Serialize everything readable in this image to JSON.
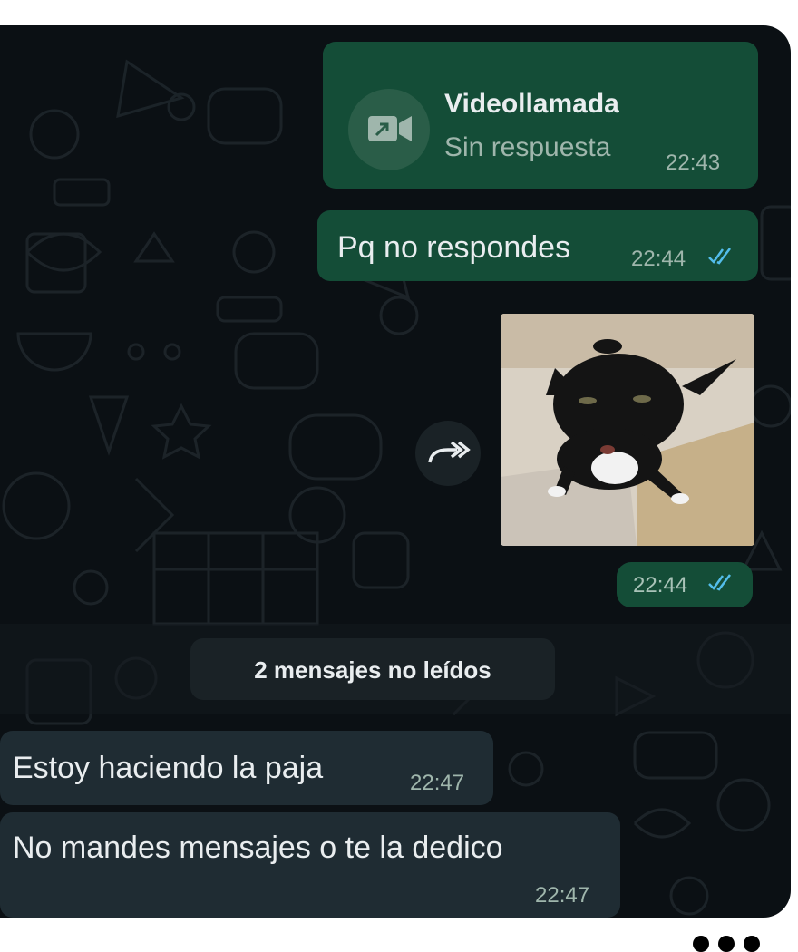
{
  "call_bubble": {
    "title": "Videollamada",
    "subtitle": "Sin respuesta",
    "time": "22:43",
    "icon": "video-call-missed-icon"
  },
  "messages_out": [
    {
      "text": "Pq no responde s",
      "time": "22:44",
      "status": "read"
    }
  ],
  "image_message": {
    "time": "22:44",
    "status": "read",
    "forward_icon": "forward-icon",
    "image_subject": "cat-photo"
  },
  "unread_divider": {
    "label": "2 mensajes no leídos"
  },
  "messages_in": [
    {
      "text": "Estoy haciendo la paja",
      "time": "22:47"
    },
    {
      "text": "No mandes mensajes o te la dedico",
      "time": "22:47"
    }
  ],
  "colors": {
    "background": "#0b1014",
    "outgoing_bubble": "#144d37",
    "incoming_bubble": "#1f2c33",
    "read_ticks": "#53bdeb"
  }
}
